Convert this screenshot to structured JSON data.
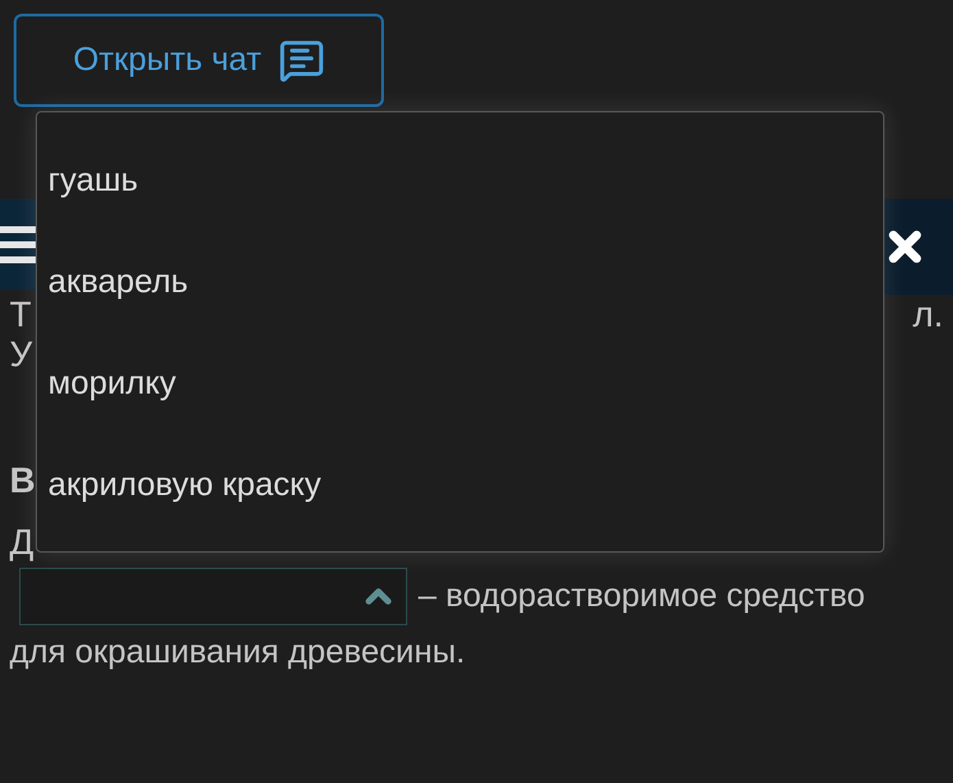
{
  "chat_button": {
    "label": "Открыть чат"
  },
  "text_fragments": {
    "line_1_start": "Т",
    "line_1_end": "л.",
    "line_2_start": "У",
    "heading_start": "В",
    "line_3_start": "Д"
  },
  "question": {
    "answer_field": {
      "expanded": true
    },
    "after_field": "– водорастворимое средство",
    "continuation": "для окрашивания древесины."
  },
  "dropdown": {
    "options": [
      {
        "label": "гуашь",
        "selected": false
      },
      {
        "label": "акварель",
        "selected": false
      },
      {
        "label": "морилку",
        "selected": false
      },
      {
        "label": "акриловую краску",
        "selected": false
      }
    ]
  }
}
